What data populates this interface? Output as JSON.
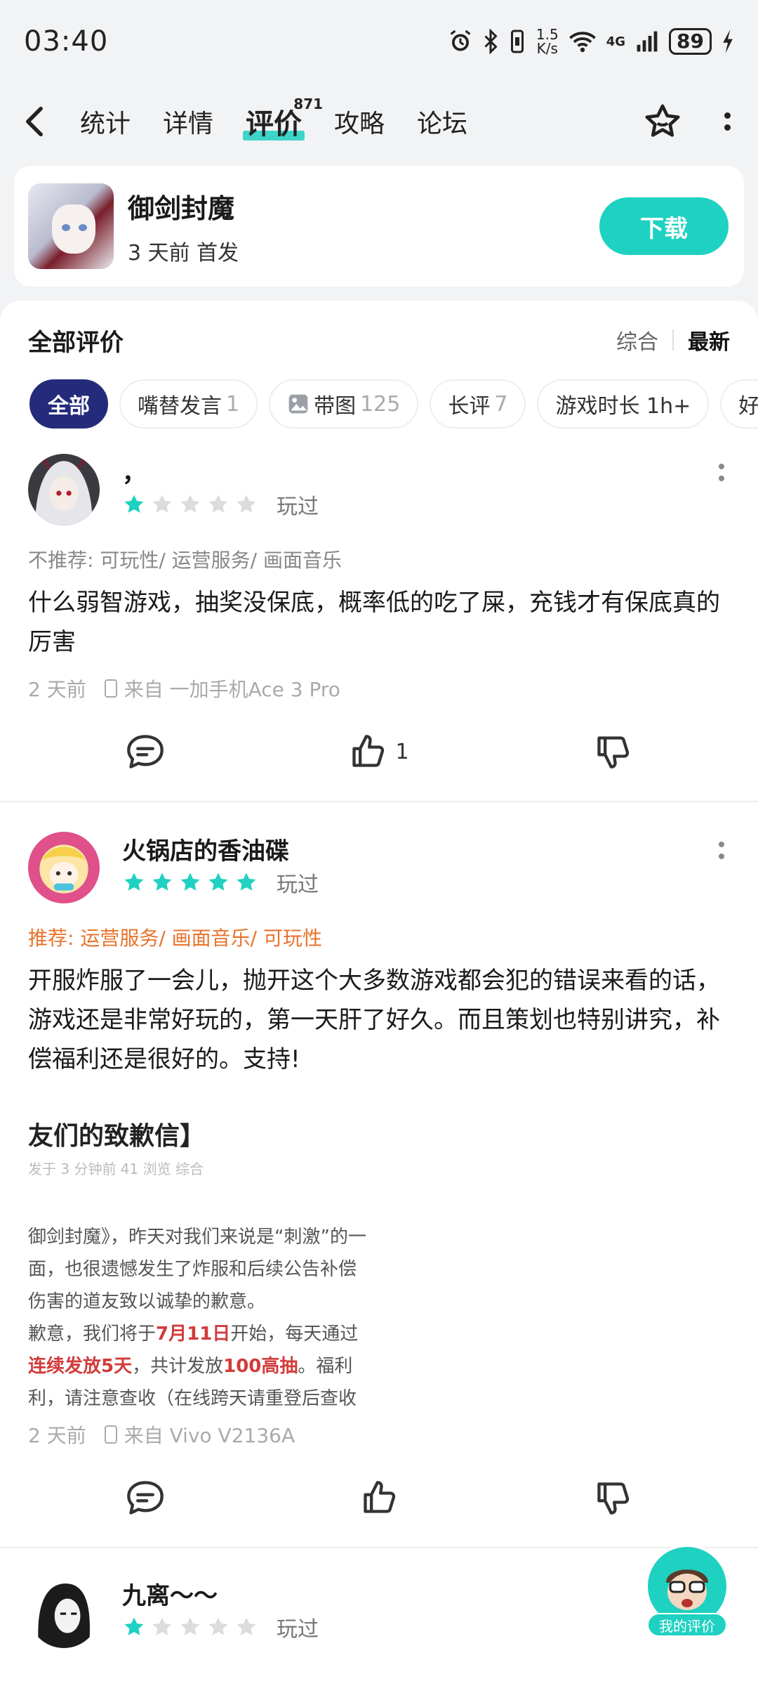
{
  "status_bar": {
    "time": "03:40",
    "net_speed_value": "1.5",
    "net_speed_unit": "K/s",
    "battery": "89",
    "signal_label": "4G"
  },
  "nav": {
    "tabs": [
      {
        "label": "统计"
      },
      {
        "label": "详情"
      },
      {
        "label": "评价",
        "badge": "871",
        "active": true
      },
      {
        "label": "攻略"
      },
      {
        "label": "论坛"
      }
    ]
  },
  "app": {
    "name": "御剑封魔",
    "release": "3 天前 首发",
    "download_label": "下载"
  },
  "reviews_panel": {
    "title": "全部评价",
    "sort_options": [
      "综合",
      "最新"
    ],
    "sort_active": "最新",
    "chips": [
      {
        "label": "全部",
        "count": ""
      },
      {
        "label": "嘴替发言",
        "count": "1"
      },
      {
        "label": "带图",
        "count": "125"
      },
      {
        "label": "长评",
        "count": "7"
      },
      {
        "label": "游戏时长 1h+",
        "count": ""
      },
      {
        "label": "好评",
        "count": ""
      }
    ]
  },
  "reviews": [
    {
      "username": "，",
      "rating": 1,
      "played": "玩过",
      "verdict": "不推荐: 可玩性/ 运营服务/ 画面音乐",
      "text": "什么弱智游戏，抽奖没保底，概率低的吃了屎，充钱才有保底真的厉害",
      "time": "2 天前",
      "device": "来自 一加手机Ace 3 Pro",
      "likes": "1"
    },
    {
      "username": "火锅店的香油碟",
      "rating": 5,
      "played": "玩过",
      "verdict": "推荐: 运营服务/ 画面音乐/ 可玩性",
      "text": "开服炸服了一会儿，抛开这个大多数游戏都会犯的错误来看的话，游戏还是非常好玩的，第一天肝了好久。而且策划也特别讲究，补偿福利还是很好的。支持!",
      "image": {
        "title": "友们的致歉信】",
        "meta": "发于 3 分钟前  41 浏览  综合",
        "lines": [
          "御剑封魔》，昨天对我们来说是“刺激”的一",
          "面，也很遗憾发生了炸服和后续公告补偿",
          "伤害的道友致以诚挚的歉意。",
          "歉意，我们将于7月11日开始，每天通过",
          "连续发放5天，共计发放100高抽。福利",
          "利，请注意查收（在线跨天请重登后查收"
        ]
      },
      "time": "2 天前",
      "device": "来自 Vivo V2136A",
      "likes": ""
    },
    {
      "username": "九离～～",
      "rating": 1,
      "played": "玩过"
    }
  ],
  "fab": {
    "label": "我的评价"
  },
  "colors": {
    "accent": "#1fd1c1",
    "chip_active": "#242b7a",
    "positive": "#e8732c"
  }
}
